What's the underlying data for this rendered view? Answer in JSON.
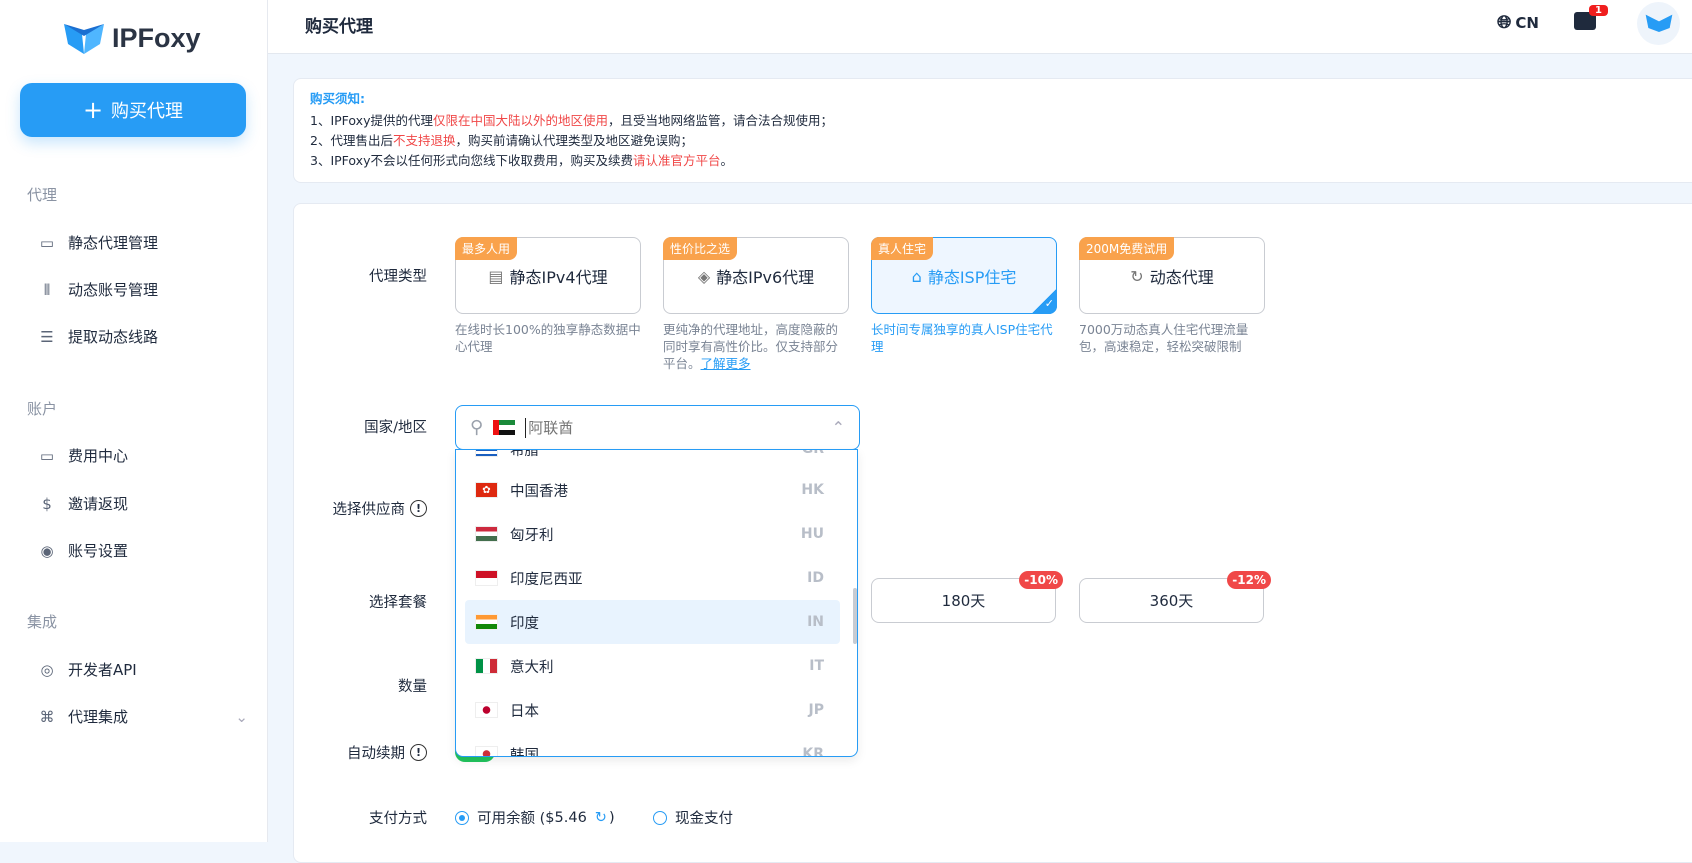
{
  "brand": "IPFoxy",
  "sidebar": {
    "buy_label": "购买代理",
    "sections": [
      {
        "title": "代理",
        "items": [
          "静态代理管理",
          "动态账号管理",
          "提取动态线路"
        ]
      },
      {
        "title": "账户",
        "items": [
          "费用中心",
          "邀请返现",
          "账号设置"
        ]
      },
      {
        "title": "集成",
        "items": [
          "开发者API",
          "代理集成"
        ]
      }
    ]
  },
  "header": {
    "title": "购买代理",
    "lang": "CN",
    "notif_count": "1"
  },
  "notice": {
    "title": "购买须知:",
    "l1a": "1、IPFoxy提供的代理",
    "l1b": "仅限在中国大陆以外的地区使用",
    "l1c": "，且受当地网络监管，请合法合规使用；",
    "l2a": "2、代理售出后",
    "l2b": "不支持退换",
    "l2c": "，购买前请确认代理类型及地区避免误购；",
    "l3a": "3、IPFoxy不会以任何形式向您线下收取费用，购买及续费",
    "l3b": "请认准官方平台",
    "l3c": "。"
  },
  "form": {
    "labels": {
      "type": "代理类型",
      "country": "国家/地区",
      "supplier": "选择供应商",
      "plan": "选择套餐",
      "qty": "数量",
      "renew": "自动续期",
      "pay": "支付方式"
    },
    "types": [
      {
        "tag": "最多人用",
        "name": "静态IPv4代理",
        "desc": "在线时长100%的独享静态数据中心代理"
      },
      {
        "tag": "性价比之选",
        "name": "静态IPv6代理",
        "desc": "更纯净的代理地址，高度隐蔽的同时享有高性价比。仅支持部分平台。",
        "link": "了解更多"
      },
      {
        "tag": "真人住宅",
        "name": "静态ISP住宅",
        "desc": "长时间专属独享的真人ISP住宅代理",
        "selected": true
      },
      {
        "tag": "200M免费试用",
        "name": "动态代理",
        "desc": "7000万动态真人住宅代理流量包，高速稳定，轻松突破限制"
      }
    ],
    "country_placeholder": "阿联酋",
    "countries": [
      {
        "name": "希腊",
        "code": "GR"
      },
      {
        "name": "中国香港",
        "code": "HK"
      },
      {
        "name": "匈牙利",
        "code": "HU"
      },
      {
        "name": "印度尼西亚",
        "code": "ID"
      },
      {
        "name": "印度",
        "code": "IN"
      },
      {
        "name": "意大利",
        "code": "IT"
      },
      {
        "name": "日本",
        "code": "JP"
      },
      {
        "name": "韩国",
        "code": "KR"
      }
    ],
    "plans": [
      {
        "label": "180天",
        "discount": "-10%"
      },
      {
        "label": "360天",
        "discount": "-12%"
      }
    ],
    "pay": {
      "balance_label": "可用余额 (",
      "balance": "$5.46",
      "close": ")",
      "cash": "现金支付"
    }
  },
  "colors": {
    "accent": "#279cf5",
    "tag": "#f9a24c",
    "danger": "#f04848"
  }
}
